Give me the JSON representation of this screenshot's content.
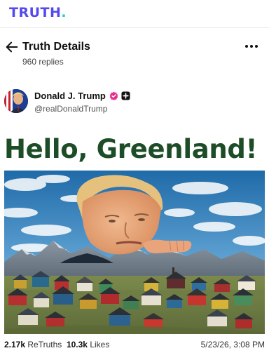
{
  "app": {
    "logo_text": "TRUTH",
    "logo_dot": ".",
    "brand_color": "#5448ee",
    "accent_color": "#1dd1c4"
  },
  "header": {
    "title": "Truth Details",
    "replies": "960 replies",
    "back_icon": "arrow-left-icon",
    "menu_icon": "more-horizontal-icon"
  },
  "post": {
    "author_name": "Donald J. Trump",
    "handle": "@realDonaldTrump",
    "verified_icon": "verified-badge-icon",
    "extra_badge_icon": "plus-badge-icon",
    "headline": "Hello, Greenland!",
    "headline_color": "#1d4d27"
  },
  "stats": {
    "retruths_count": "2.17k",
    "retruths_label": "ReTruths",
    "likes_count": "10.3k",
    "likes_label": "Likes",
    "datetime": "5/23/26, 3:08 PM"
  }
}
